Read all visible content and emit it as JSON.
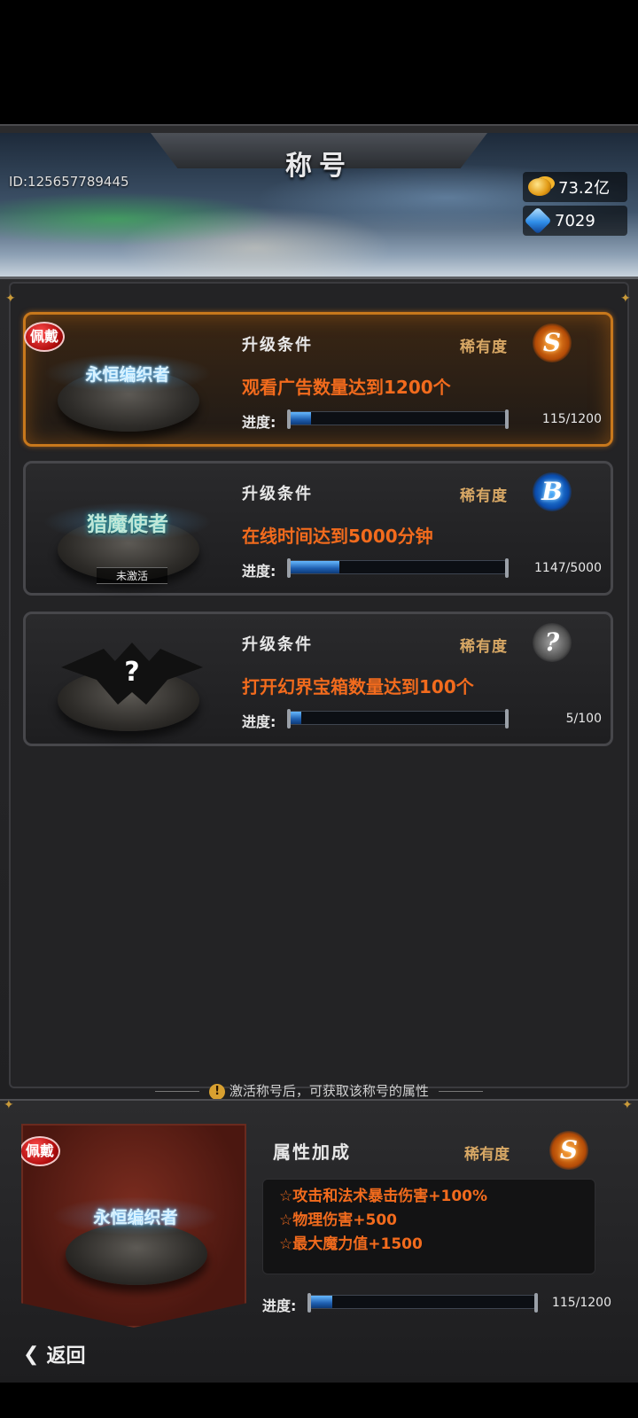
{
  "header": {
    "title": "称号",
    "player_id": "ID:125657789445",
    "gold": "73.2亿",
    "gems": "7029"
  },
  "titles": [
    {
      "name": "永恒编织者",
      "equipped_tag": "佩戴",
      "condition_label": "升级条件",
      "rarity_label": "稀有度",
      "rarity": "S",
      "condition": "观看广告数量达到1200个",
      "progress_label": "进度:",
      "progress_text": "115/1200",
      "progress": 0.096
    },
    {
      "name": "猎魔使者",
      "status_tag": "未激活",
      "condition_label": "升级条件",
      "rarity_label": "稀有度",
      "rarity": "B",
      "condition": "在线时间达到5000分钟",
      "progress_label": "进度:",
      "progress_text": "1147/5000",
      "progress": 0.229
    },
    {
      "name": "?",
      "condition_label": "升级条件",
      "rarity_label": "稀有度",
      "rarity": "?",
      "condition": "打开幻界宝箱数量达到100个",
      "progress_label": "进度:",
      "progress_text": "5/100",
      "progress": 0.05
    }
  ],
  "hint": "激活称号后，可获取该称号的属性",
  "detail": {
    "equipped_tag": "佩戴",
    "name": "永恒编织者",
    "attr_title": "属性加成",
    "rarity_label": "稀有度",
    "rarity": "S",
    "attributes": [
      "☆攻击和法术暴击伤害+100%",
      "☆物理伤害+500",
      "☆最大魔力值+1500"
    ],
    "progress_label": "进度:",
    "progress_text": "115/1200",
    "progress": 0.096
  },
  "back_label": "返回"
}
